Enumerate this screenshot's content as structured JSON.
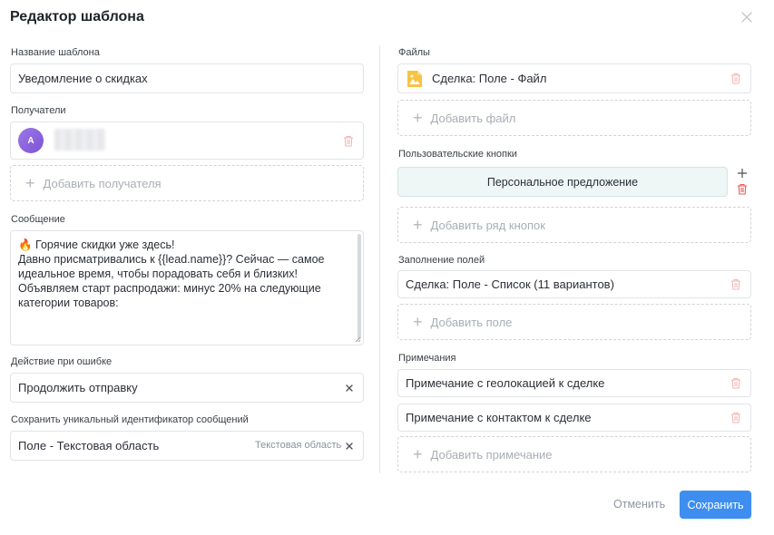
{
  "dialog": {
    "title": "Редактор шаблона"
  },
  "left": {
    "template_name": {
      "label": "Название шаблона",
      "value": "Уведомление о скидках"
    },
    "recipients": {
      "label": "Получатели",
      "items": [
        {
          "avatar_initial": "А",
          "name": ""
        }
      ],
      "add_label": "Добавить получателя"
    },
    "message": {
      "label": "Сообщение",
      "lines": [
        "🔥 Горячие скидки уже здесь!",
        "",
        "Давно присматривались к {{lead.name}}? Сейчас — самое",
        "идеальное время, чтобы порадовать себя и близких!",
        "",
        "Объявляем старт распродажи: минус 20% на следующие",
        "категории товаров:"
      ]
    },
    "on_error": {
      "label": "Действие при ошибке",
      "value": "Продолжить отправку"
    },
    "save_id": {
      "label": "Сохранить уникальный идентификатор сообщений",
      "value": "Поле - Текстовая область",
      "type_hint": "Текстовая область"
    }
  },
  "right": {
    "files": {
      "label": "Файлы",
      "items": [
        {
          "name": "Сделка: Поле - Файл",
          "icon": "image-file-icon"
        }
      ],
      "add_label": "Добавить файл"
    },
    "custom_buttons": {
      "label": "Пользовательские кнопки",
      "items": [
        {
          "label": "Персональное предложение"
        }
      ],
      "add_label": "Добавить ряд кнопок"
    },
    "fields_fill": {
      "label": "Заполнение полей",
      "items": [
        {
          "name": "Сделка: Поле - Список (11 вариантов)"
        }
      ],
      "add_label": "Добавить поле"
    },
    "notes": {
      "label": "Примечания",
      "items": [
        {
          "name": "Примечание с геолокацией к сделке"
        },
        {
          "name": "Примечание с контактом к сделке"
        }
      ],
      "add_label": "Добавить примечание"
    }
  },
  "footer": {
    "cancel_label": "Отменить",
    "save_label": "Сохранить"
  },
  "colors": {
    "accent": "#3d8ef0",
    "danger_icon": "#f0a8a8",
    "avatar": "#8a63dc",
    "custom_button_bg": "#eef6f6"
  }
}
